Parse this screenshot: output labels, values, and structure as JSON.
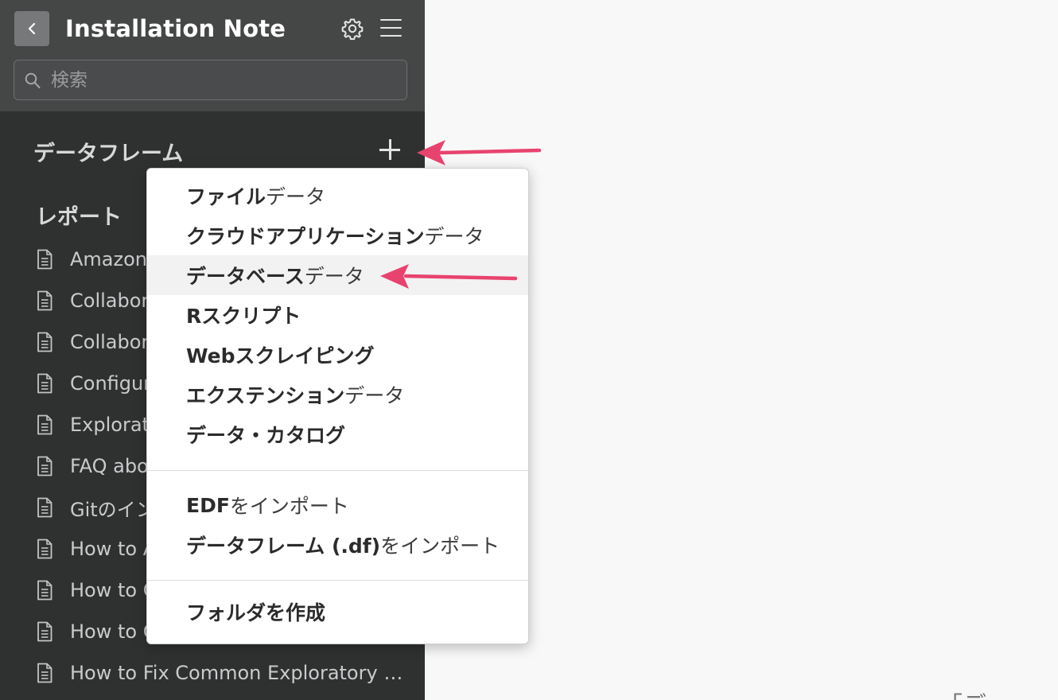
{
  "header": {
    "back_icon": "chevron-left-icon",
    "title": "Installation Note",
    "settings_icon": "gear-icon",
    "menu_icon": "hamburger-menu-icon"
  },
  "search": {
    "placeholder": "検索",
    "value": ""
  },
  "dataframes": {
    "title": "データフレーム",
    "add_icon": "plus-icon"
  },
  "reports": {
    "title": "レポート",
    "items": [
      {
        "label": "Amazon"
      },
      {
        "label": "Collabor"
      },
      {
        "label": "Collabor"
      },
      {
        "label": "Configur"
      },
      {
        "label": "Explorat"
      },
      {
        "label": "FAQ abo"
      },
      {
        "label": "Gitのイン"
      },
      {
        "label": "How to A"
      },
      {
        "label": "How to C"
      },
      {
        "label": "How to C"
      },
      {
        "label": "How to Fix Common Exploratory …"
      }
    ]
  },
  "menu": {
    "groups": [
      [
        {
          "bold": "ファイル",
          "light": "データ"
        },
        {
          "bold": "クラウドアプリケーション",
          "light": "データ"
        },
        {
          "bold": "データベース",
          "light": "データ",
          "highlighted": true
        },
        {
          "bold": "Rスクリプト",
          "light": ""
        },
        {
          "bold": "Webスクレイピング",
          "light": ""
        },
        {
          "bold": "エクステンション",
          "light": "データ"
        },
        {
          "bold": "データ・カタログ",
          "light": ""
        }
      ],
      [
        {
          "bold": "EDF",
          "light": "をインポート"
        },
        {
          "bold": "データフレーム (.df)",
          "light": "をインポート"
        }
      ],
      [
        {
          "bold": "フォルダを作成",
          "light": ""
        }
      ]
    ]
  },
  "main": {
    "partial_text": "「デ"
  },
  "colors": {
    "sidebar_bg": "#2f3131",
    "header_bg": "#454646",
    "annotation_arrow": "#e8436e",
    "menu_highlight": "#f2f2f2"
  }
}
